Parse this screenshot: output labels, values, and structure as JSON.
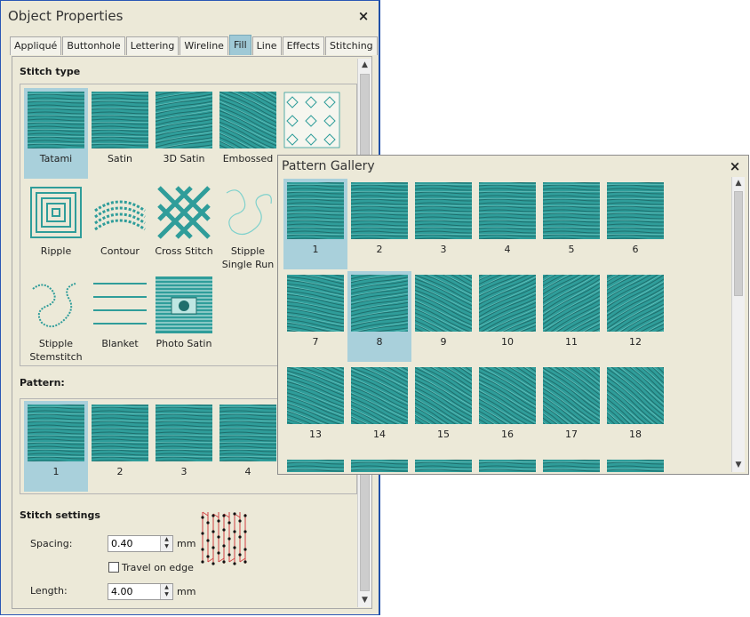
{
  "object_properties": {
    "title": "Object Properties",
    "close_glyph": "×",
    "tabs": [
      "Appliqué",
      "Buttonhole",
      "Lettering",
      "Wireline",
      "Fill",
      "Line",
      "Effects",
      "Stitching"
    ],
    "active_tab": "Fill",
    "stitch_type": {
      "heading": "Stitch type",
      "items": [
        {
          "label": "Tatami",
          "icon": "tatami-icon",
          "selected": true
        },
        {
          "label": "Satin",
          "icon": "satin-icon",
          "selected": false
        },
        {
          "label": "3D Satin",
          "icon": "3d-satin-icon",
          "selected": false
        },
        {
          "label": "Embossed",
          "icon": "embossed-icon",
          "selected": false
        },
        {
          "label": "",
          "icon": "motif-fill-icon",
          "selected": false
        },
        {
          "label": "Ripple",
          "icon": "ripple-icon",
          "selected": false
        },
        {
          "label": "Contour",
          "icon": "contour-icon",
          "selected": false
        },
        {
          "label": "Cross Stitch",
          "icon": "cross-stitch-icon",
          "selected": false
        },
        {
          "label": "Stipple Single Run",
          "icon": "stipple-single-run-icon",
          "selected": false
        },
        {
          "label": "Stipple Stemstitch",
          "icon": "stipple-stemstitch-icon",
          "selected": false
        },
        {
          "label": "Blanket",
          "icon": "blanket-icon",
          "selected": false
        },
        {
          "label": "Photo Satin",
          "icon": "photo-satin-icon",
          "selected": false
        }
      ]
    },
    "pattern": {
      "heading": "Pattern:",
      "items": [
        {
          "label": "1",
          "selected": true
        },
        {
          "label": "2",
          "selected": false
        },
        {
          "label": "3",
          "selected": false
        },
        {
          "label": "4",
          "selected": false
        }
      ]
    },
    "stitch_settings": {
      "heading": "Stitch settings",
      "spacing_label": "Spacing:",
      "spacing_value": "0.40",
      "spacing_unit": "mm",
      "travel_label": "Travel on edge",
      "travel_checked": false,
      "length_label": "Length:",
      "length_value": "4.00",
      "length_unit": "mm",
      "preview_icon": "stitch-preview-icon"
    }
  },
  "pattern_gallery": {
    "title": "Pattern Gallery",
    "close_glyph": "×",
    "items": [
      {
        "label": "1",
        "selected": true
      },
      {
        "label": "2",
        "selected": false
      },
      {
        "label": "3",
        "selected": false
      },
      {
        "label": "4",
        "selected": false
      },
      {
        "label": "5",
        "selected": false
      },
      {
        "label": "6",
        "selected": false
      },
      {
        "label": "7",
        "selected": false
      },
      {
        "label": "8",
        "selected": true
      },
      {
        "label": "9",
        "selected": false
      },
      {
        "label": "10",
        "selected": false
      },
      {
        "label": "11",
        "selected": false
      },
      {
        "label": "12",
        "selected": false
      },
      {
        "label": "13",
        "selected": false
      },
      {
        "label": "14",
        "selected": false
      },
      {
        "label": "15",
        "selected": false
      },
      {
        "label": "16",
        "selected": false
      },
      {
        "label": "17",
        "selected": false
      },
      {
        "label": "18",
        "selected": false
      },
      {
        "label": "",
        "selected": false
      },
      {
        "label": "",
        "selected": false
      },
      {
        "label": "",
        "selected": false
      },
      {
        "label": "",
        "selected": false
      },
      {
        "label": "",
        "selected": false
      },
      {
        "label": "",
        "selected": false
      }
    ]
  },
  "colors": {
    "thread": "#2f9d9a",
    "thread_dark": "#1f6e6c",
    "thread_light": "#7fd1cc",
    "selection": "#a9d0db"
  }
}
